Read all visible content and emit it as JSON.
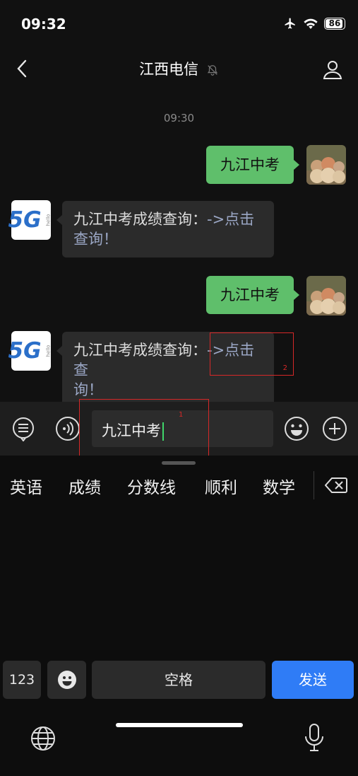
{
  "status_bar": {
    "time": "09:32",
    "battery": "86"
  },
  "nav": {
    "title": "江西电信"
  },
  "chat": {
    "timestamp": "09:30",
    "messages": [
      {
        "type": "out",
        "text": "九江中考"
      },
      {
        "type": "in",
        "text": "九江中考成绩查询：",
        "link": "->点击查询！"
      },
      {
        "type": "out",
        "text": "九江中考"
      },
      {
        "type": "in",
        "text": "九江中考成绩查询：",
        "link_line1": "->点击查",
        "link_line2": "询！"
      }
    ],
    "annotations": {
      "box1": "1",
      "box2": "2"
    },
    "logo_text": "5G",
    "logo_sub": "hello"
  },
  "input": {
    "value": "九江中考"
  },
  "keyboard": {
    "candidates": [
      "英语",
      "成绩",
      "分数线",
      "顺利",
      "数学"
    ],
    "num_key": "123",
    "space_key": "空格",
    "send_key": "发送"
  },
  "colors": {
    "accent_green": "#5fbf6b",
    "send_blue": "#2f7cf6",
    "annotation_red": "#d62828"
  }
}
